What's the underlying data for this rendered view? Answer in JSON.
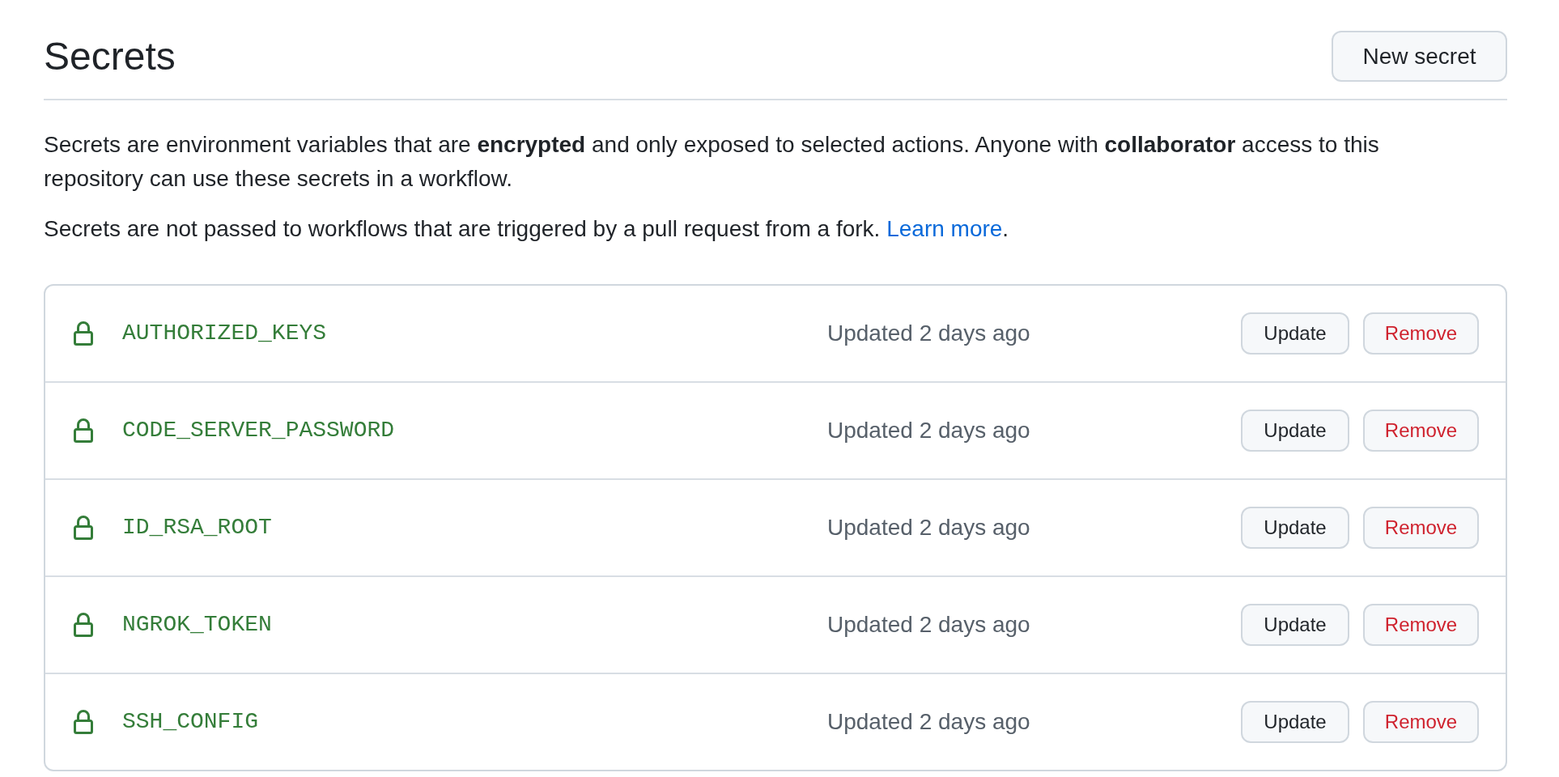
{
  "header": {
    "title": "Secrets",
    "new_button": "New secret"
  },
  "description": "Secrets are environment variables that are **encrypted** and only exposed to selected actions. Anyone with **collaborator** access to this repository can use these secrets in a workflow.",
  "note": {
    "text": "Secrets are not passed to workflows that are triggered by a pull request from a fork.",
    "link": "Learn more",
    "after_link": "."
  },
  "secrets": [
    {
      "name": "AUTHORIZED_KEYS",
      "updated": "Updated 2 days ago",
      "update_button": "Update",
      "remove_button": "Remove"
    },
    {
      "name": "CODE_SERVER_PASSWORD",
      "updated": "Updated 2 days ago",
      "update_button": "Update",
      "remove_button": "Remove"
    },
    {
      "name": "ID_RSA_ROOT",
      "updated": "Updated 2 days ago",
      "update_button": "Update",
      "remove_button": "Remove"
    },
    {
      "name": "NGROK_TOKEN",
      "updated": "Updated 2 days ago",
      "update_button": "Update",
      "remove_button": "Remove"
    },
    {
      "name": "SSH_CONFIG",
      "updated": "Updated 2 days ago",
      "update_button": "Update",
      "remove_button": "Remove"
    }
  ]
}
